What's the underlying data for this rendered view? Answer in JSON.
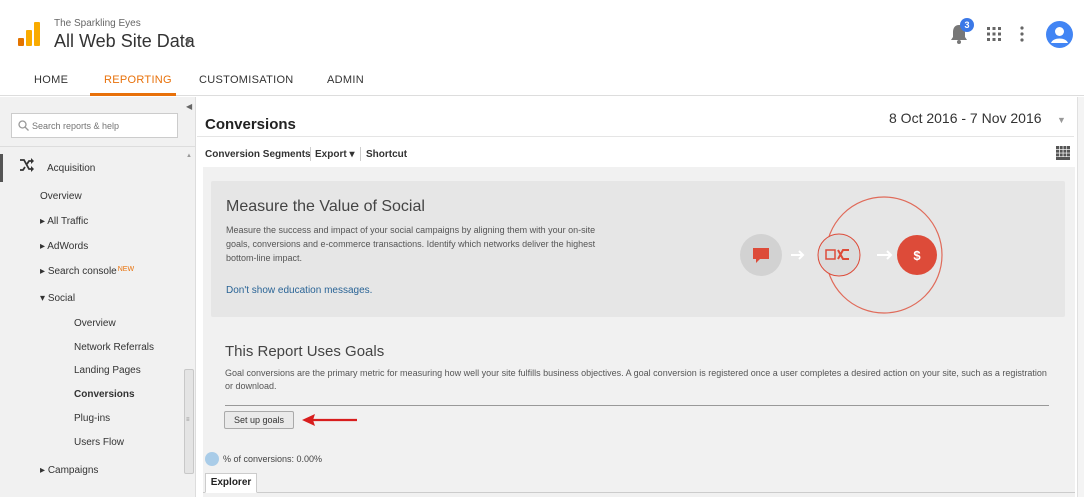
{
  "header": {
    "account_name": "The Sparkling Eyes",
    "property_name": "All Web Site Data",
    "notification_count": "3",
    "icons": [
      "analytics-logo-icon",
      "chevron-down-icon",
      "bell-icon",
      "apps-grid-icon",
      "more-vert-icon",
      "avatar-icon"
    ]
  },
  "nav": {
    "tabs": [
      {
        "label": "HOME"
      },
      {
        "label": "REPORTING",
        "active": true
      },
      {
        "label": "CUSTOMISATION"
      },
      {
        "label": "ADMIN"
      }
    ]
  },
  "sidebar": {
    "search_placeholder": "Search reports & help",
    "section": "Acquisition",
    "items": [
      {
        "label": "Overview"
      },
      {
        "label": "All Traffic"
      },
      {
        "label": "AdWords"
      },
      {
        "label": "Search console",
        "badge": "NEW"
      },
      {
        "label": "Social"
      },
      {
        "label": "Overview"
      },
      {
        "label": "Network Referrals"
      },
      {
        "label": "Landing Pages"
      },
      {
        "label": "Conversions",
        "selected": true
      },
      {
        "label": "Plug-ins"
      },
      {
        "label": "Users Flow"
      },
      {
        "label": "Campaigns"
      }
    ],
    "arrow_collapsed": "▸",
    "arrow_expanded": "▾"
  },
  "main": {
    "title": "Conversions",
    "date_range": "8 Oct 2016 - 7 Nov 2016",
    "toolbar": {
      "segments_label": "Conversion Segments",
      "export_label": "Export",
      "export_caret": "▾",
      "shortcut_label": "Shortcut"
    },
    "education": {
      "title": "Measure the Value of Social",
      "body": "Measure the success and impact of your social campaigns by aligning them with your on-site goals, conversions and e-commerce transactions. Identify which networks deliver the highest bottom-line impact.",
      "dismiss_link": "Don't show education messages.",
      "graphic_dollar": "$"
    },
    "goals": {
      "title": "This Report Uses Goals",
      "body": "Goal conversions are the primary metric for measuring how well your site fulfills business objectives. A goal conversion is registered once a user completes a desired action on your site, such as a registration or download.",
      "button_label": "Set up goals"
    },
    "metric_label": "% of conversions: 0.00%",
    "explorer_tab": "Explorer"
  },
  "colors": {
    "accent_orange": "#e8710a",
    "logo_yellow": "#f9ab00",
    "logo_orange": "#e37400",
    "social_red": "#dd4b39",
    "link_blue": "#2a6496",
    "avatar_blue": "#4285f4"
  }
}
